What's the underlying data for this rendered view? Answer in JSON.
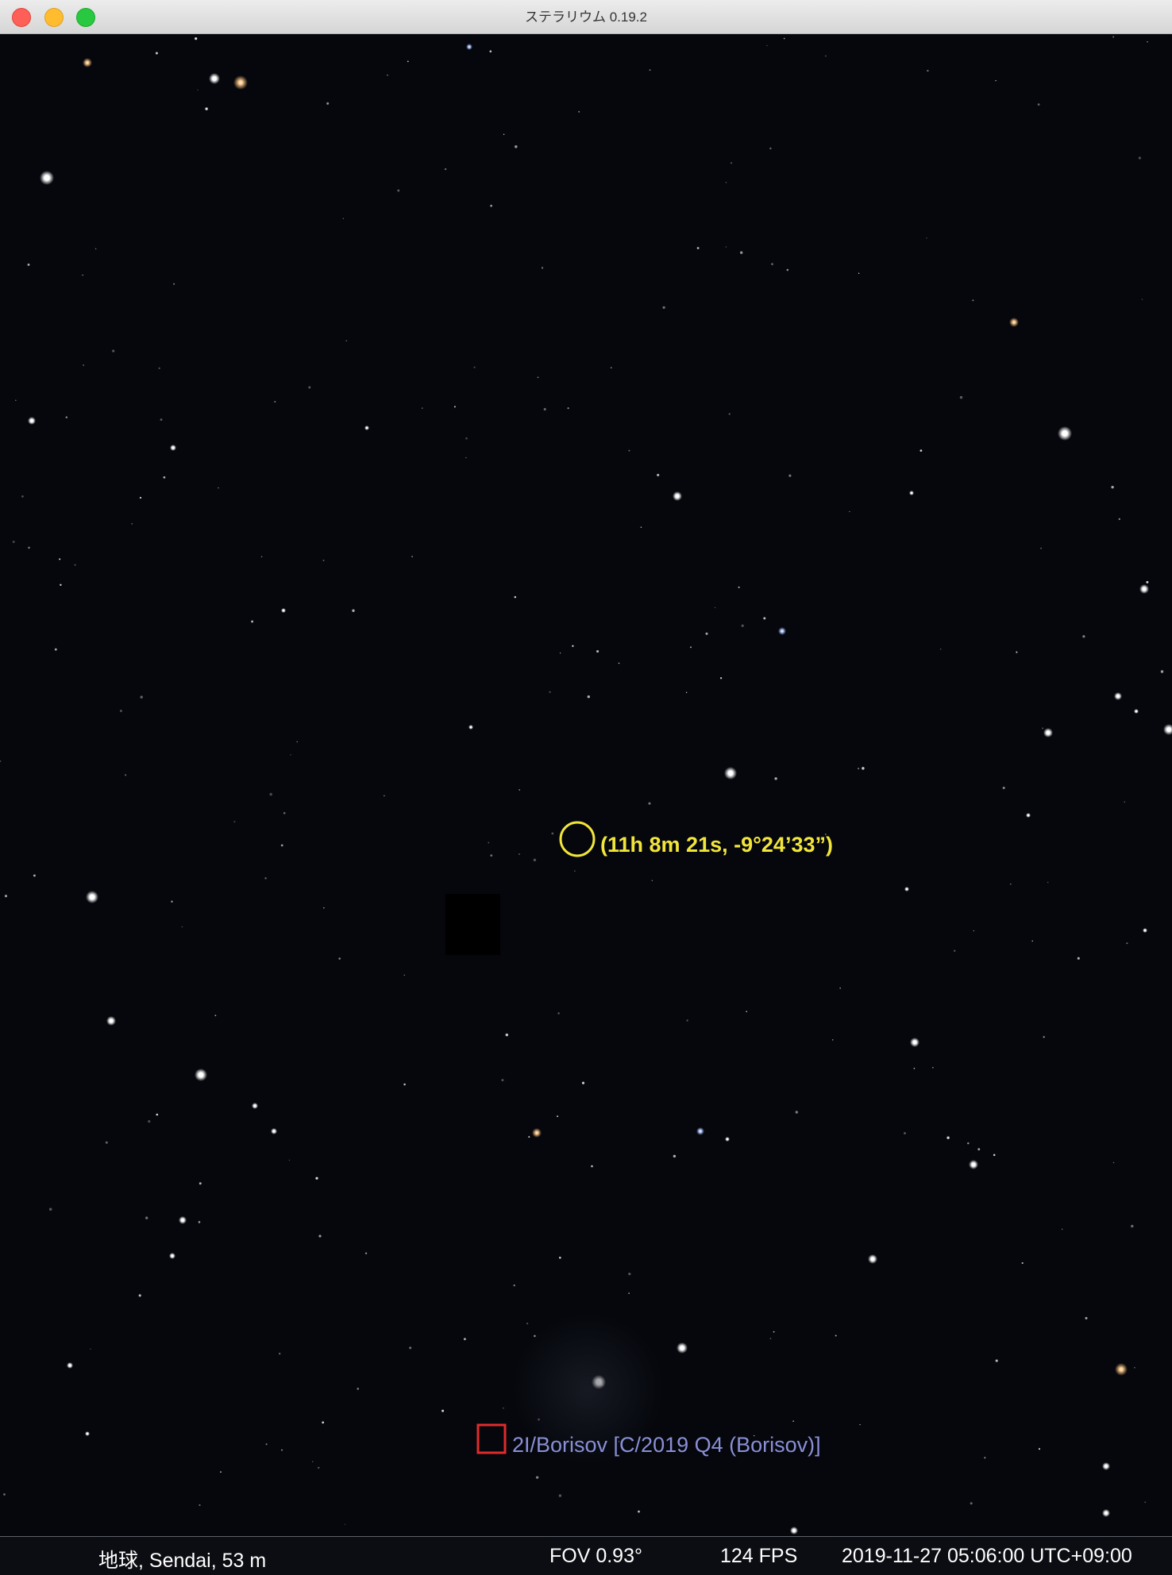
{
  "window": {
    "title": "ステラリウム 0.19.2"
  },
  "selection": {
    "coordinates_label": "(11h 8m 21s, -9°24’33”)",
    "marker_color": "#f2e53a"
  },
  "object": {
    "label": "2I/Borisov [C/2019 Q4 (Borisov)]",
    "marker_color": "#e02b2b",
    "label_color": "#8a8fd6"
  },
  "status": {
    "location": "地球, Sendai, 53 m",
    "fov": "FOV 0.93°",
    "fps": "124 FPS",
    "datetime": "2019-11-27 05:06:00 UTC+09:00"
  }
}
